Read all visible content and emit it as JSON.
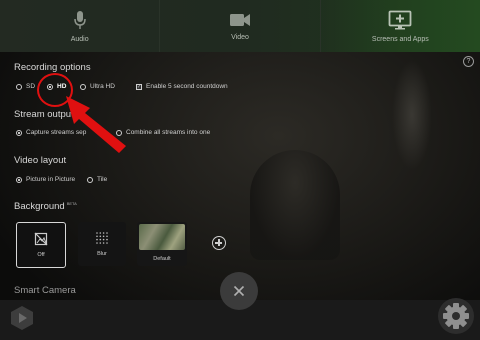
{
  "tabs": [
    {
      "label": "Audio",
      "icon": "microphone-icon"
    },
    {
      "label": "Video",
      "icon": "video-camera-icon"
    },
    {
      "label": "Screens and Apps",
      "icon": "screen-add-icon"
    }
  ],
  "recording": {
    "title": "Recording options",
    "sd_label": "SD",
    "hd_label": "HD",
    "ultrahd_label": "Ultra HD",
    "countdown_label": "Enable 5 second countdown",
    "selected": "HD",
    "countdown_checked": true
  },
  "stream_output": {
    "title": "Stream output",
    "capture_label": "Capture streams sep",
    "combine_label": "Combine all streams into one",
    "selected": "Capture streams separately"
  },
  "video_layout": {
    "title": "Video layout",
    "pip_label": "Picture in Picture",
    "tile_label": "Tile",
    "selected": "Picture in Picture"
  },
  "background": {
    "title": "Background",
    "beta": "BETA",
    "cards": [
      {
        "label": "Off",
        "icon": "no-background-icon",
        "selected": true
      },
      {
        "label": "Blur",
        "icon": "blur-dots-icon",
        "selected": false
      },
      {
        "label": "Default",
        "icon": "landscape-thumbnail",
        "selected": false
      }
    ],
    "add_icon": "plus-circle-icon"
  },
  "smart_camera": {
    "title": "Smart Camera"
  },
  "colors": {
    "annotation": "#e01010",
    "topbar_accent": "#244a20"
  }
}
